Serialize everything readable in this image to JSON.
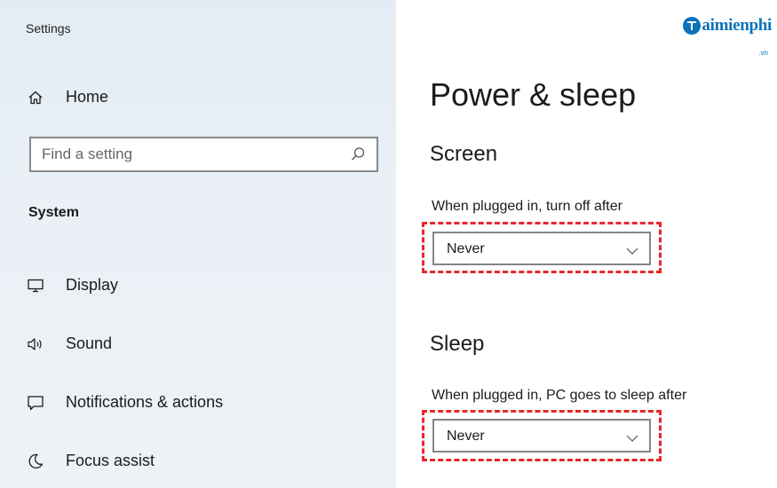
{
  "window": {
    "title": "Settings"
  },
  "brand": {
    "name": "aimienphi",
    "suffix": ".vn",
    "color": "#0c72b9"
  },
  "sidebar": {
    "home": {
      "label": "Home",
      "icon": "home-icon"
    },
    "search": {
      "placeholder": "Find a setting",
      "value": "",
      "icon": "search-icon"
    },
    "section": "System",
    "items": [
      {
        "label": "Display",
        "icon": "display-icon"
      },
      {
        "label": "Sound",
        "icon": "sound-icon"
      },
      {
        "label": "Notifications & actions",
        "icon": "notifications-icon"
      },
      {
        "label": "Focus assist",
        "icon": "focus-assist-icon"
      }
    ]
  },
  "main": {
    "title": "Power & sleep",
    "screen": {
      "heading": "Screen",
      "label": "When plugged in, turn off after",
      "value": "Never"
    },
    "sleep": {
      "heading": "Sleep",
      "label": "When plugged in, PC goes to sleep after",
      "value": "Never"
    }
  },
  "colors": {
    "highlight_dash": "#e8262b",
    "sidebar_bg": "#e6eef5"
  }
}
